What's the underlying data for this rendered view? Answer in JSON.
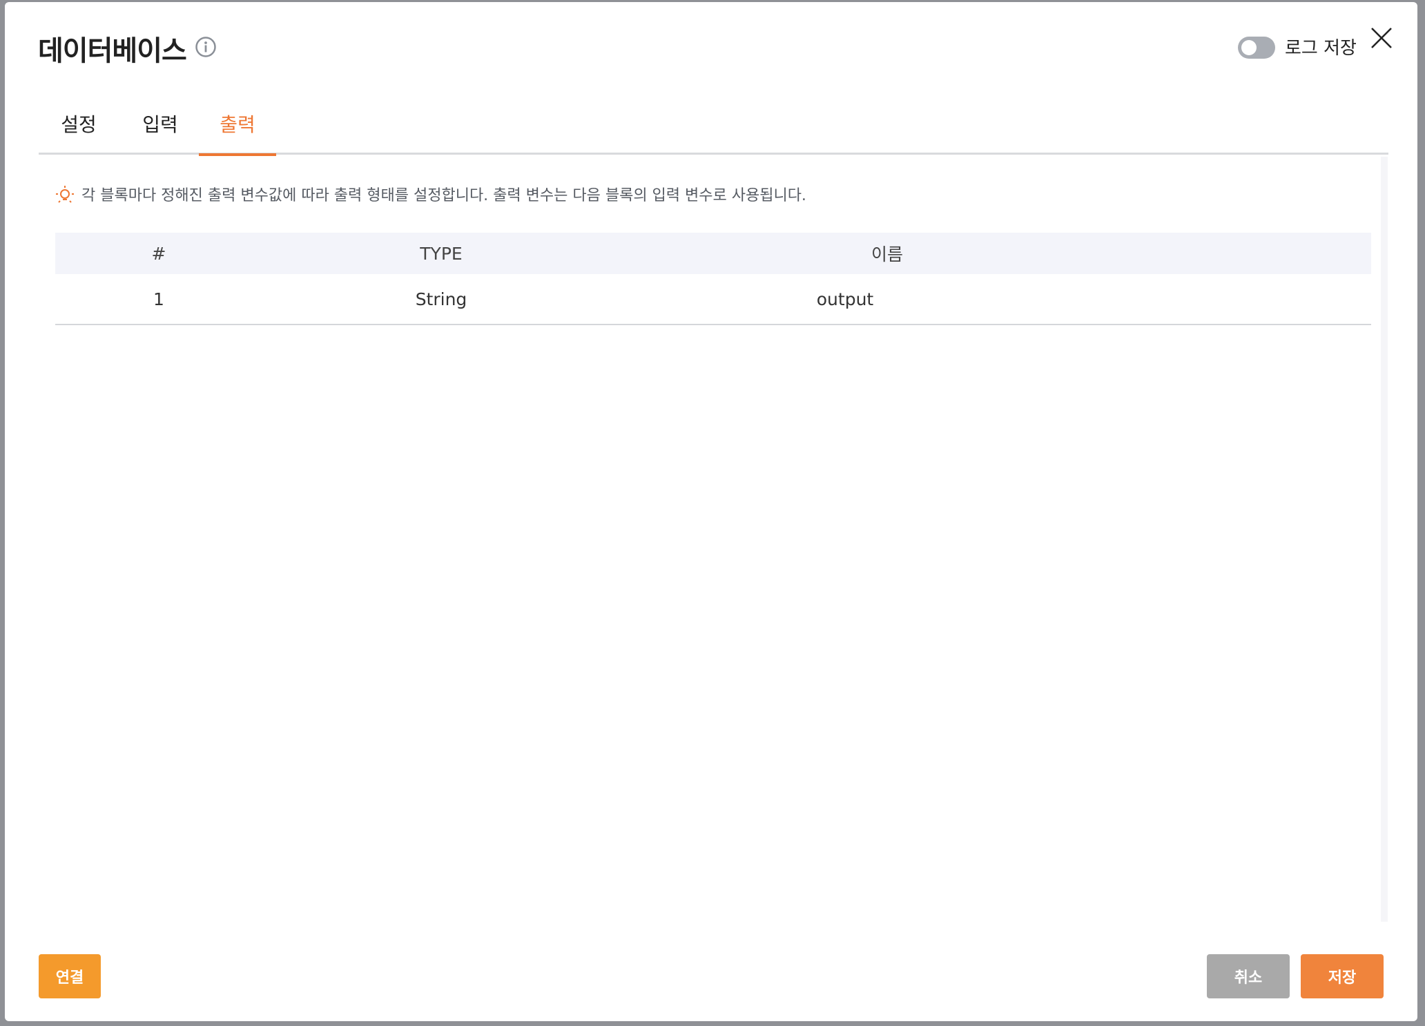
{
  "dialog": {
    "title": "데이터베이스",
    "log_toggle": {
      "label": "로그 저장",
      "on": false
    }
  },
  "tabs": [
    {
      "label": "설정",
      "active": false
    },
    {
      "label": "입력",
      "active": false
    },
    {
      "label": "출력",
      "active": true
    }
  ],
  "output": {
    "hint": "각 블록마다 정해진 출력 변수값에 따라 출력 형태를 설정합니다. 출력 변수는 다음 블록의 입력 변수로 사용됩니다.",
    "columns": [
      "#",
      "TYPE",
      "이름"
    ],
    "rows": [
      {
        "index": "1",
        "type": "String",
        "name": "output"
      }
    ]
  },
  "footer": {
    "connect_label": "연결",
    "cancel_label": "취소",
    "save_label": "저장"
  },
  "colors": {
    "accent": "#ee7733",
    "connect_button": "#f49a2c",
    "save_button": "#f0843c",
    "cancel_button": "#a9a9a9"
  },
  "icons": {
    "info": "info-icon",
    "close": "close-icon",
    "hint": "lightbulb-icon"
  }
}
